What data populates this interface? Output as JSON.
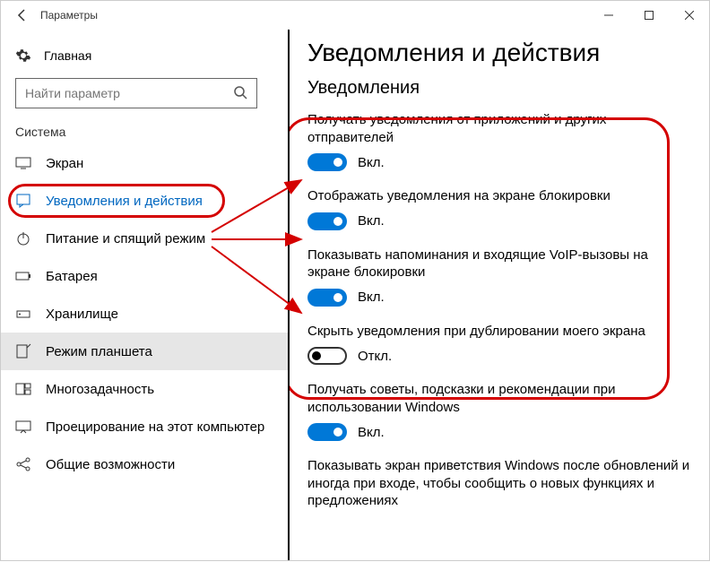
{
  "window": {
    "title": "Параметры"
  },
  "sidebar": {
    "home": "Главная",
    "search_placeholder": "Найти параметр",
    "section": "Система",
    "items": [
      {
        "label": "Экран"
      },
      {
        "label": "Уведомления и действия"
      },
      {
        "label": "Питание и спящий режим"
      },
      {
        "label": "Батарея"
      },
      {
        "label": "Хранилище"
      },
      {
        "label": "Режим планшета"
      },
      {
        "label": "Многозадачность"
      },
      {
        "label": "Проецирование на этот компьютер"
      },
      {
        "label": "Общие возможности"
      }
    ]
  },
  "main": {
    "heading": "Уведомления и действия",
    "subheading": "Уведомления",
    "settings": [
      {
        "desc": "Получать уведомления от приложений и других отправителей",
        "on": true,
        "state": "Вкл."
      },
      {
        "desc": "Отображать уведомления на экране блокировки",
        "on": true,
        "state": "Вкл."
      },
      {
        "desc": "Показывать напоминания и входящие VoIP-вызовы на экране блокировки",
        "on": true,
        "state": "Вкл."
      },
      {
        "desc": "Скрыть уведомления при дублировании моего экрана",
        "on": false,
        "state": "Откл."
      },
      {
        "desc": "Получать советы, подсказки и рекомендации при использовании Windows",
        "on": true,
        "state": "Вкл."
      },
      {
        "desc": "Показывать экран приветствия Windows после обновлений и иногда при входе, чтобы сообщить о новых функциях и предложениях",
        "on": true,
        "state": ""
      }
    ]
  }
}
